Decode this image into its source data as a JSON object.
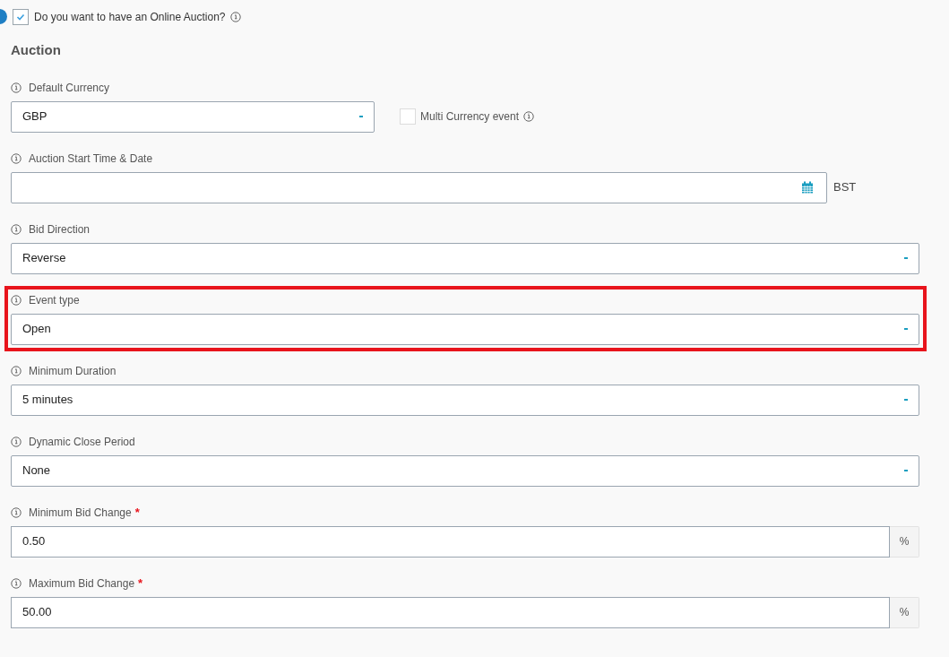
{
  "online_auction": {
    "label": "Do you want to have an Online Auction?",
    "checked": true
  },
  "section_title": "Auction",
  "fields": [
    {
      "kind": "select",
      "label": "Default Currency",
      "value": "GBP",
      "highlighted": false,
      "side_checkbox": {
        "label": "Multi Currency event",
        "checked": false
      }
    },
    {
      "kind": "datetime",
      "label": "Auction Start Time & Date",
      "suffix": "BST",
      "highlighted": false
    },
    {
      "kind": "select",
      "label": "Bid Direction",
      "value": "Reverse",
      "highlighted": false
    },
    {
      "kind": "select",
      "label": "Event type",
      "value": "Open",
      "highlighted": true
    },
    {
      "kind": "select",
      "label": "Minimum Duration",
      "value": "5 minutes",
      "highlighted": false
    },
    {
      "kind": "select",
      "label": "Dynamic Close Period",
      "value": "None",
      "highlighted": false
    },
    {
      "kind": "number",
      "label": "Minimum Bid Change",
      "required_mark": "*",
      "value": "0.50",
      "addon": "%",
      "highlighted": false
    },
    {
      "kind": "number",
      "label": "Maximum Bid Change",
      "required_mark": "*",
      "value": "50.00",
      "addon": "%",
      "highlighted": false
    }
  ]
}
